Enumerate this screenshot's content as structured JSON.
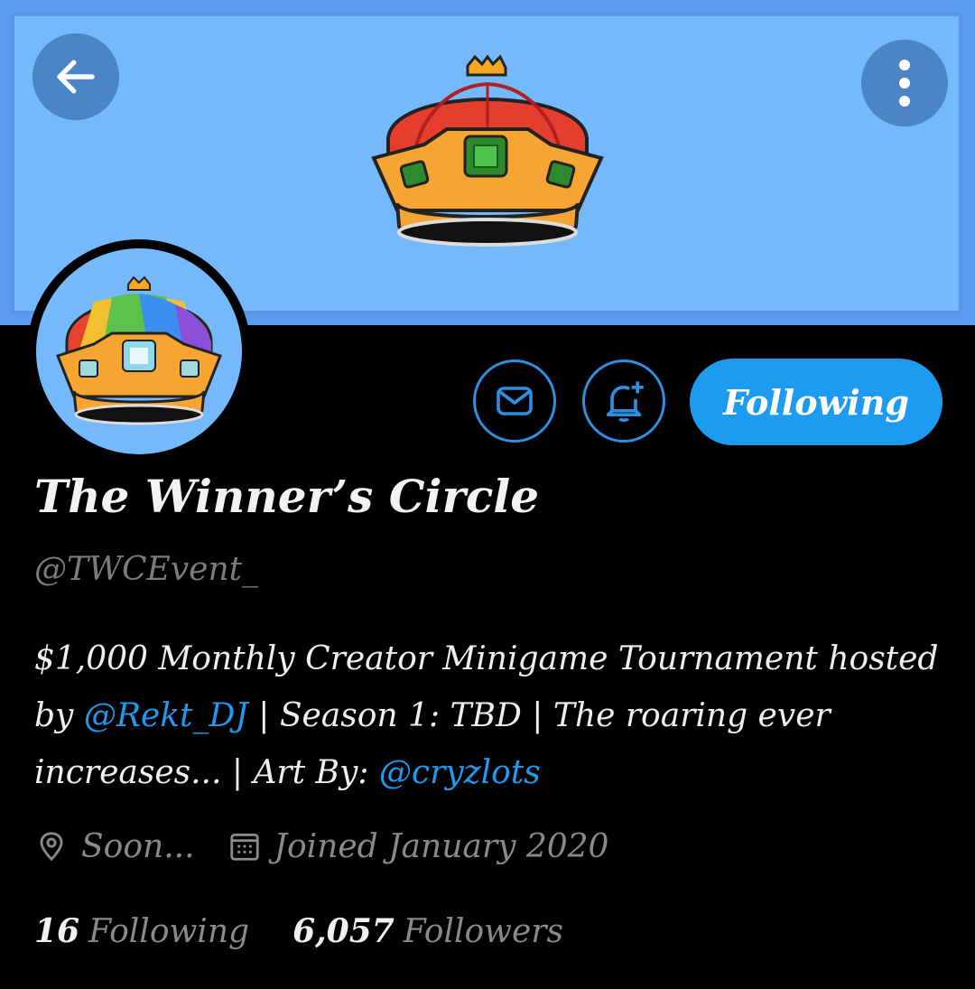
{
  "header": {
    "back_icon": "arrow-left-icon",
    "more_icon": "more-vertical-icon"
  },
  "profile": {
    "name": "The Winner’s Circle",
    "handle": "@TWCEvent_",
    "bio": {
      "text1": "$1,000 Monthly Creator Minigame Tournament hosted by ",
      "mention1": "@Rekt_DJ",
      "text2": " | Season 1: TBD | The roaring ever increases... | Art By: ",
      "mention2": "@cryzlots"
    },
    "location": "Soon...",
    "joined": "Joined January 2020",
    "following_count": "16",
    "following_label": "Following",
    "followers_count": "6,057",
    "followers_label": "Followers"
  },
  "actions": {
    "message_icon": "mail-icon",
    "notify_icon": "bell-plus-icon",
    "follow_label": "Following"
  },
  "colors": {
    "accent": "#1d9bf0",
    "banner": "#73b9fb",
    "background": "#000000"
  }
}
